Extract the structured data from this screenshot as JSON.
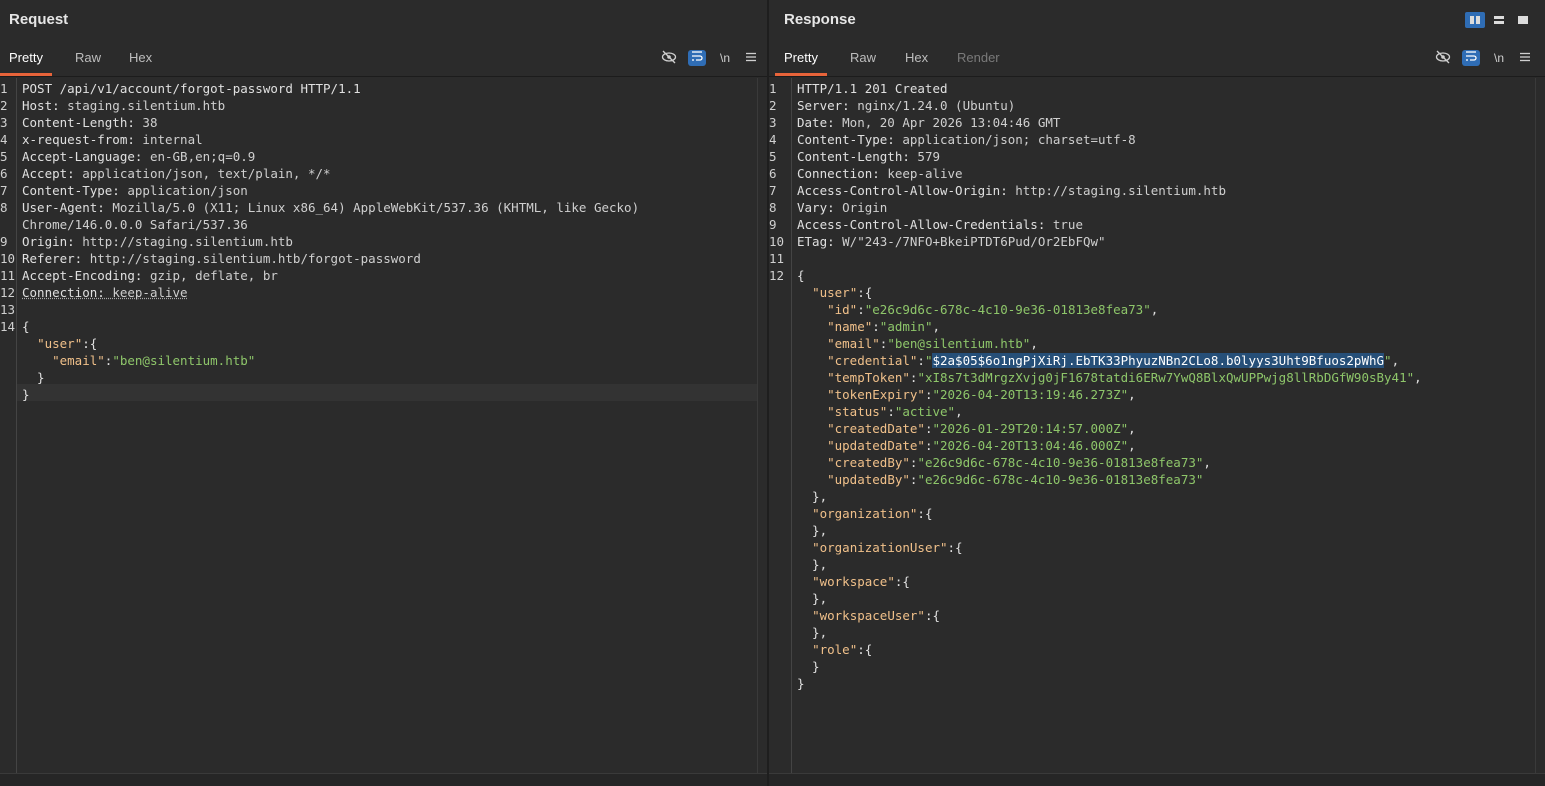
{
  "request": {
    "title": "Request",
    "tabs": [
      "Pretty",
      "Raw",
      "Hex"
    ],
    "tools": [
      "eye-off-icon",
      "wrap-icon",
      "\\n",
      "menu-icon"
    ],
    "newline_label": "\\n",
    "line_numbers": [
      "1",
      "2",
      "3",
      "4",
      "5",
      "6",
      "7",
      "8",
      "9",
      "10",
      "11",
      "12",
      "13",
      "14"
    ],
    "lines": [
      [
        [
          "POST /api/v1/account/forgot-password HTTP/1.1",
          "hname"
        ]
      ],
      [
        [
          "Host: ",
          "hname"
        ],
        [
          "staging.silentium.htb",
          "hval"
        ]
      ],
      [
        [
          "Content-Length: ",
          "hname"
        ],
        [
          "38",
          "hval"
        ]
      ],
      [
        [
          "x-request-from: ",
          "hname"
        ],
        [
          "internal",
          "hval"
        ]
      ],
      [
        [
          "Accept-Language: ",
          "hname"
        ],
        [
          "en-GB,en;q=0.9",
          "hval"
        ]
      ],
      [
        [
          "Accept: ",
          "hname"
        ],
        [
          "application/json, text/plain, */*",
          "hval"
        ]
      ],
      [
        [
          "Content-Type: ",
          "hname"
        ],
        [
          "application/json",
          "hval"
        ]
      ],
      [
        [
          "User-Agent: ",
          "hname"
        ],
        [
          "Mozilla/5.0 (X11; Linux x86_64) AppleWebKit/537.36 (KHTML, like Gecko)",
          "hval"
        ]
      ],
      [
        [
          "Chrome/146.0.0.0 Safari/537.36",
          "hval"
        ]
      ],
      [
        [
          "Origin: ",
          "hname"
        ],
        [
          "http://staging.silentium.htb",
          "hval"
        ]
      ],
      [
        [
          "Referer: ",
          "hname"
        ],
        [
          "http://staging.silentium.htb/forgot-password",
          "hval"
        ]
      ],
      [
        [
          "Accept-Encoding: ",
          "hname"
        ],
        [
          "gzip, deflate, br",
          "hval"
        ]
      ],
      [
        [
          "Connection: ",
          "hname under"
        ],
        [
          "keep-alive",
          "hval under"
        ]
      ],
      [
        [
          "",
          "pun"
        ]
      ],
      [
        [
          "{",
          "pun"
        ]
      ],
      [
        [
          "  ",
          "pun"
        ],
        [
          "\"user\"",
          "key"
        ],
        [
          ":{",
          "pun"
        ]
      ],
      [
        [
          "    ",
          "pun"
        ],
        [
          "\"email\"",
          "key"
        ],
        [
          ":",
          "pun"
        ],
        [
          "\"ben@silentium.htb\"",
          "str"
        ]
      ],
      [
        [
          "  }",
          "pun"
        ]
      ],
      [
        [
          "}",
          "pun"
        ]
      ]
    ],
    "line_number_rows": [
      0,
      1,
      2,
      3,
      4,
      5,
      6,
      7,
      9,
      10,
      11,
      12,
      13,
      14
    ]
  },
  "response": {
    "title": "Response",
    "tabs": [
      "Pretty",
      "Raw",
      "Hex",
      "Render"
    ],
    "tools": [
      "eye-off-icon",
      "wrap-icon",
      "\\n",
      "menu-icon"
    ],
    "newline_label": "\\n",
    "line_numbers": [
      "1",
      "2",
      "3",
      "4",
      "5",
      "6",
      "7",
      "8",
      "9",
      "10",
      "11",
      "12"
    ],
    "lines": [
      [
        [
          "HTTP/1.1 201 Created",
          "hname"
        ]
      ],
      [
        [
          "Server: ",
          "hname"
        ],
        [
          "nginx/1.24.0 (Ubuntu)",
          "hval"
        ]
      ],
      [
        [
          "Date: ",
          "hname"
        ],
        [
          "Mon, 20 Apr 2026 13:04:46 GMT",
          "hval"
        ]
      ],
      [
        [
          "Content-Type: ",
          "hname"
        ],
        [
          "application/json; charset=utf-8",
          "hval"
        ]
      ],
      [
        [
          "Content-Length: ",
          "hname"
        ],
        [
          "579",
          "hval"
        ]
      ],
      [
        [
          "Connection: ",
          "hname"
        ],
        [
          "keep-alive",
          "hval"
        ]
      ],
      [
        [
          "Access-Control-Allow-Origin: ",
          "hname"
        ],
        [
          "http://staging.silentium.htb",
          "hval"
        ]
      ],
      [
        [
          "Vary: ",
          "hname"
        ],
        [
          "Origin",
          "hval"
        ]
      ],
      [
        [
          "Access-Control-Allow-Credentials: ",
          "hname"
        ],
        [
          "true",
          "hval"
        ]
      ],
      [
        [
          "ETag: ",
          "hname"
        ],
        [
          "W/\"243-/7NFO+BkeiPTDT6Pud/Or2EbFQw\"",
          "hval"
        ]
      ],
      [
        [
          "",
          "pun"
        ]
      ],
      [
        [
          "{",
          "pun"
        ]
      ],
      [
        [
          "  ",
          "pun"
        ],
        [
          "\"user\"",
          "key"
        ],
        [
          ":{",
          "pun"
        ]
      ],
      [
        [
          "    ",
          "pun"
        ],
        [
          "\"id\"",
          "key"
        ],
        [
          ":",
          "pun"
        ],
        [
          "\"e26c9d6c-678c-4c10-9e36-01813e8fea73\"",
          "str"
        ],
        [
          ",",
          "pun"
        ]
      ],
      [
        [
          "    ",
          "pun"
        ],
        [
          "\"name\"",
          "key"
        ],
        [
          ":",
          "pun"
        ],
        [
          "\"admin\"",
          "str"
        ],
        [
          ",",
          "pun"
        ]
      ],
      [
        [
          "    ",
          "pun"
        ],
        [
          "\"email\"",
          "key"
        ],
        [
          ":",
          "pun"
        ],
        [
          "\"ben@silentium.htb\"",
          "str"
        ],
        [
          ",",
          "pun"
        ]
      ],
      [
        [
          "    ",
          "pun"
        ],
        [
          "\"credential\"",
          "key"
        ],
        [
          ":",
          "pun"
        ],
        [
          "\"",
          "str"
        ],
        [
          "$2a$05$6o1ngPjXiRj.EbTK33PhyuzNBn2CLo8.b0lyys3Uht9Bfuos2pWhG",
          "sel"
        ],
        [
          "\"",
          "str"
        ],
        [
          ",",
          "pun"
        ]
      ],
      [
        [
          "    ",
          "pun"
        ],
        [
          "\"tempToken\"",
          "key"
        ],
        [
          ":",
          "pun"
        ],
        [
          "\"xI8s7t3dMrgzXvjg0jF1678tatdi6ERw7YwQ8BlxQwUPPwjg8llRbDGfW90sBy41\"",
          "str"
        ],
        [
          ",",
          "pun"
        ]
      ],
      [
        [
          "    ",
          "pun"
        ],
        [
          "\"tokenExpiry\"",
          "key"
        ],
        [
          ":",
          "pun"
        ],
        [
          "\"2026-04-20T13:19:46.273Z\"",
          "str"
        ],
        [
          ",",
          "pun"
        ]
      ],
      [
        [
          "    ",
          "pun"
        ],
        [
          "\"status\"",
          "key"
        ],
        [
          ":",
          "pun"
        ],
        [
          "\"active\"",
          "str"
        ],
        [
          ",",
          "pun"
        ]
      ],
      [
        [
          "    ",
          "pun"
        ],
        [
          "\"createdDate\"",
          "key"
        ],
        [
          ":",
          "pun"
        ],
        [
          "\"2026-01-29T20:14:57.000Z\"",
          "str"
        ],
        [
          ",",
          "pun"
        ]
      ],
      [
        [
          "    ",
          "pun"
        ],
        [
          "\"updatedDate\"",
          "key"
        ],
        [
          ":",
          "pun"
        ],
        [
          "\"2026-04-20T13:04:46.000Z\"",
          "str"
        ],
        [
          ",",
          "pun"
        ]
      ],
      [
        [
          "    ",
          "pun"
        ],
        [
          "\"createdBy\"",
          "key"
        ],
        [
          ":",
          "pun"
        ],
        [
          "\"e26c9d6c-678c-4c10-9e36-01813e8fea73\"",
          "str"
        ],
        [
          ",",
          "pun"
        ]
      ],
      [
        [
          "    ",
          "pun"
        ],
        [
          "\"updatedBy\"",
          "key"
        ],
        [
          ":",
          "pun"
        ],
        [
          "\"e26c9d6c-678c-4c10-9e36-01813e8fea73\"",
          "str"
        ]
      ],
      [
        [
          "  },",
          "pun"
        ]
      ],
      [
        [
          "  ",
          "pun"
        ],
        [
          "\"organization\"",
          "key"
        ],
        [
          ":{",
          "pun"
        ]
      ],
      [
        [
          "  },",
          "pun"
        ]
      ],
      [
        [
          "  ",
          "pun"
        ],
        [
          "\"organizationUser\"",
          "key"
        ],
        [
          ":{",
          "pun"
        ]
      ],
      [
        [
          "  },",
          "pun"
        ]
      ],
      [
        [
          "  ",
          "pun"
        ],
        [
          "\"workspace\"",
          "key"
        ],
        [
          ":{",
          "pun"
        ]
      ],
      [
        [
          "  },",
          "pun"
        ]
      ],
      [
        [
          "  ",
          "pun"
        ],
        [
          "\"workspaceUser\"",
          "key"
        ],
        [
          ":{",
          "pun"
        ]
      ],
      [
        [
          "  },",
          "pun"
        ]
      ],
      [
        [
          "  ",
          "pun"
        ],
        [
          "\"role\"",
          "key"
        ],
        [
          ":{",
          "pun"
        ]
      ],
      [
        [
          "  }",
          "pun"
        ]
      ],
      [
        [
          "}",
          "pun"
        ]
      ]
    ],
    "line_number_rows": [
      0,
      1,
      2,
      3,
      4,
      5,
      6,
      7,
      8,
      9,
      10,
      11
    ]
  },
  "layout_toggle": [
    "side-by-side-icon",
    "stacked-icon",
    "single-icon"
  ],
  "colors": {
    "accent": "#e8643a",
    "selection": "#264f78",
    "toggle_on": "#2f6db5"
  }
}
